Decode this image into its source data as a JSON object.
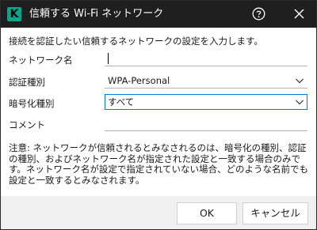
{
  "window": {
    "title": "信頼する Wi-Fi ネットワーク"
  },
  "form": {
    "intro": "接続を認証したい信頼するネットワークの設定を入力します。",
    "network_name_label": "ネットワーク名",
    "network_name_value": "",
    "auth_label": "認証種別",
    "auth_value": "WPA-Personal",
    "encryption_label": "暗号化種別",
    "encryption_value": "すべて",
    "comment_label": "コメント",
    "comment_value": ""
  },
  "note": "注意: ネットワークが信頼されるとみなされるのは、暗号化の種別、認証の種別、およびネットワーク名が指定された設定と一致する場合のみです。ネットワーク名が設定で指定されていない場合、どのような名前でも設定と一致するとみなされます。",
  "buttons": {
    "ok": "OK",
    "cancel": "キャンセル"
  },
  "icons": {
    "logo": "kaspersky-k-logo",
    "help": "help-icon",
    "close": "close-icon",
    "dropdown": "chevron-down-icon"
  },
  "colors": {
    "titlebar": "#1f1f1f",
    "logo": "#00a88e",
    "focus": "#0078d7",
    "footer": "#f0f0f0"
  }
}
